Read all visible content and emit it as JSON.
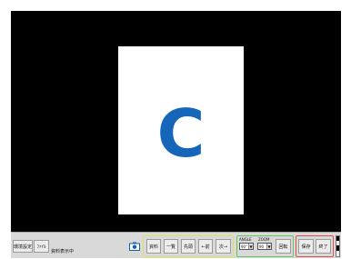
{
  "slide": {
    "letter": "C",
    "letter_color": "#1565b8"
  },
  "toolbar": {
    "env_label": "環境設定",
    "file_label": "ﾌｧｲﾙ",
    "status_text": "資料表示中",
    "camera_icon": "camera-icon",
    "nav": {
      "material": "資料",
      "list": "一覧",
      "top": "先頭",
      "prev": "←前",
      "next": "次→"
    },
    "angle": {
      "label": "ANGLE",
      "value": "90°"
    },
    "zoom": {
      "label": "ZOOM",
      "value": "90"
    },
    "apply_label": "回転",
    "save_label": "保存",
    "exit_label": "終了"
  },
  "colors": {
    "nav_group": "#e0e060",
    "view_group": "#5fc85f",
    "end_group": "#e05050"
  }
}
